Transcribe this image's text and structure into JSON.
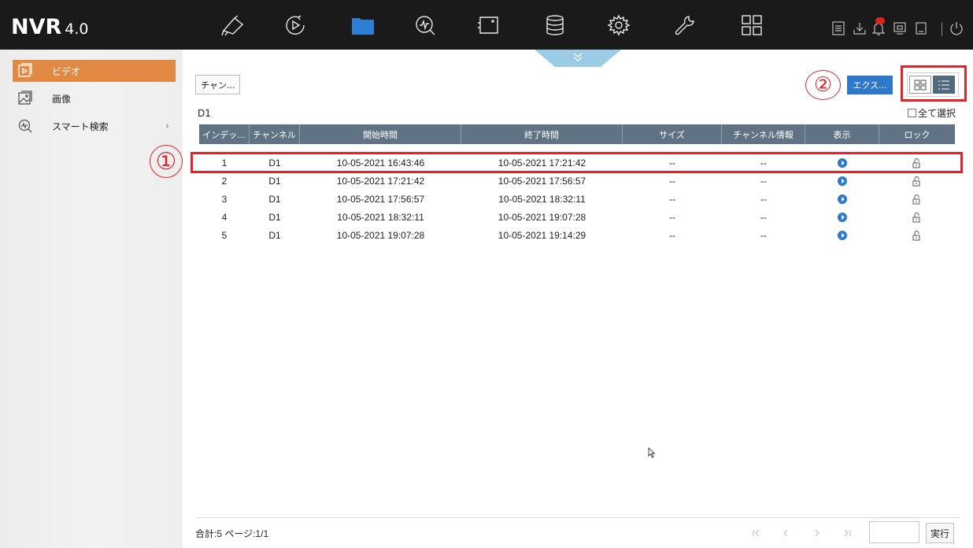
{
  "app": {
    "name": "NVR",
    "version": "4.0"
  },
  "topnav": [
    {
      "icon": "camera-icon"
    },
    {
      "icon": "playback-icon"
    },
    {
      "icon": "folder-icon",
      "active": true
    },
    {
      "icon": "smart-search-icon"
    },
    {
      "icon": "display-icon"
    },
    {
      "icon": "storage-icon"
    },
    {
      "icon": "settings-icon"
    },
    {
      "icon": "maintenance-icon"
    },
    {
      "icon": "menu-grid-icon"
    }
  ],
  "sysicons": [
    "log-icon",
    "download-icon",
    "notification-icon",
    "lock-screen-icon",
    "power-icon"
  ],
  "sidebar": {
    "items": [
      {
        "label": "ビデオ",
        "icon": "video-file-icon",
        "active": true
      },
      {
        "label": "画像",
        "icon": "picture-icon"
      },
      {
        "label": "スマート検索",
        "icon": "smart-search-icon",
        "has_submenu": true
      }
    ]
  },
  "toolbar": {
    "channel_button": "チャン...",
    "channel_label": "D1",
    "export_button": "エクス...",
    "select_all": "全て選択"
  },
  "table": {
    "columns": [
      "インデッ...",
      "チャンネル",
      "開始時間",
      "終了時間",
      "サイズ",
      "チャンネル情報",
      "表示",
      "ロック"
    ],
    "rows": [
      {
        "index": "1",
        "channel": "D1",
        "start": "10-05-2021 16:43:46",
        "end": "10-05-2021 17:21:42",
        "size": "--",
        "info": "--"
      },
      {
        "index": "2",
        "channel": "D1",
        "start": "10-05-2021 17:21:42",
        "end": "10-05-2021 17:56:57",
        "size": "--",
        "info": "--"
      },
      {
        "index": "3",
        "channel": "D1",
        "start": "10-05-2021 17:56:57",
        "end": "10-05-2021 18:32:11",
        "size": "--",
        "info": "--"
      },
      {
        "index": "4",
        "channel": "D1",
        "start": "10-05-2021 18:32:11",
        "end": "10-05-2021 19:07:28",
        "size": "--",
        "info": "--"
      },
      {
        "index": "5",
        "channel": "D1",
        "start": "10-05-2021 19:07:28",
        "end": "10-05-2021 19:14:29",
        "size": "--",
        "info": "--"
      }
    ]
  },
  "footer": {
    "summary": "合計:5 ページ:1/1",
    "go_button": "実行",
    "page_input": ""
  },
  "annotations": {
    "marker1": "①",
    "marker2": "②"
  },
  "colors": {
    "accent": "#e08a43",
    "header": "#5f7384",
    "primary_button": "#2d78c9",
    "annotation": "#e3232a"
  }
}
